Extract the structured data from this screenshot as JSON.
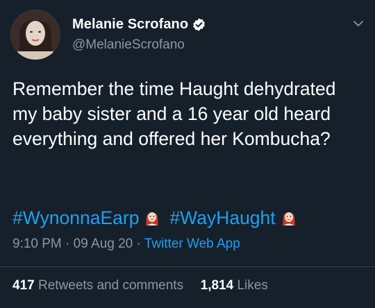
{
  "author": {
    "display_name": "Melanie Scrofano",
    "handle": "@MelanieScrofano",
    "verified": true
  },
  "tweet": {
    "text": "Remember the time Haught dehydrated my baby sister and a 16 year old heard everything and offered her Kombucha?",
    "hashtags": [
      "#WynonnaEarp",
      "#WayHaught"
    ],
    "emoji": "woman-red-hair-icon"
  },
  "meta": {
    "time": "9:10 PM",
    "date": "09 Aug 20",
    "sep": "·",
    "source": "Twitter Web App"
  },
  "stats": {
    "retweets_count": "417",
    "retweets_label": "Retweets and comments",
    "likes_count": "1,814",
    "likes_label": "Likes"
  },
  "colors": {
    "background": "#15202b",
    "accent": "#1da1f2",
    "secondary_text": "#8899a6",
    "divider": "#38444d"
  }
}
